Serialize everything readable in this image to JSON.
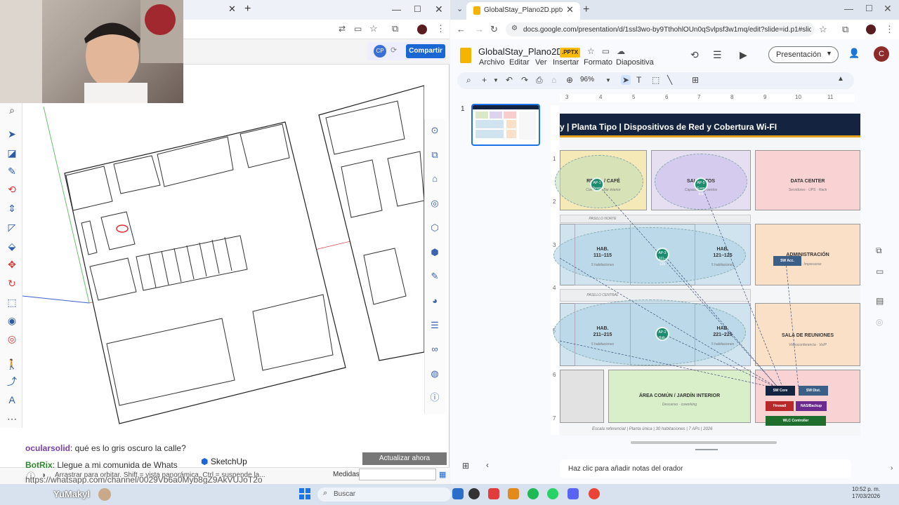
{
  "sketchup": {
    "collab_avatar": "CP",
    "share_label": "Compartir",
    "update_label": "Actualizar ahora",
    "app_badge": "SketchUp",
    "status_hint": "Arrastrar para orbitar. Shift = vista panorámica. Ctrl = suspende la...",
    "measures_label": "Medidas",
    "measures_value": ""
  },
  "chat": {
    "msg1_user": "ocularsolid",
    "msg1_text": ": qué es lo gris oscuro la calle?",
    "msg2_user": "BotRix",
    "msg2_text": ": Llegue a mi comunida de Whats",
    "msg3_text": "https://whatsapp.com/channel/0029Vb6a0Myb8gZ9AkVUJoT2o"
  },
  "browser": {
    "tab_title": "GlobalStay_Plano2D.pptx - Pres",
    "url": "docs.google.com/presentation/d/1ssl3wo-by9TthohlOUn0qSvlpsf3w1mq/edit?slide=id.p1#slide=i..."
  },
  "slides": {
    "doc_title": "GlobalStay_Plano2D",
    "file_badge": ".PPTX",
    "menus": [
      "Archivo",
      "Editar",
      "Ver",
      "Insertar",
      "Formato",
      "Diapositiva"
    ],
    "present_label": "Presentación",
    "user_initial": "C",
    "zoom": "96%",
    "slide_number": "1",
    "ruler_h": [
      "3",
      "4",
      "5",
      "6",
      "7",
      "8",
      "9",
      "10",
      "11"
    ],
    "ruler_v": [
      "1",
      "2",
      "3",
      "4",
      "5",
      "6",
      "7"
    ],
    "notes_placeholder": "Haz clic para añadir notas del orador"
  },
  "slide": {
    "title": "y  |  Planta Tipo  |  Dispositivos de Red y Cobertura Wi-FI",
    "rooms": {
      "restaurant": "RESTA        / CAFÉ",
      "restaurant_sub": "Comedor · Bar interior",
      "meeting": "SALA        NTOS",
      "meeting_sub": "Capacidad · Eventos",
      "datacenter": "DATA CENTER",
      "datacenter_sub": "Servidores · UPS · Rack",
      "hab1a": "HAB.",
      "hab1a_num": "111–115",
      "hab1a_sub": "5 habitaciones",
      "hab1b": "HAB.",
      "hab1b_num": "121–125",
      "hab1b_sub": "5 habitaciones",
      "admin": "ADMINISTRACIÓN",
      "admin_sub": "PCs · Impresoras",
      "hab2a": "HAB.",
      "hab2a_num": "211–215",
      "hab2a_sub": "5 habitaciones",
      "hab2b": "HAB.",
      "hab2b_num": "221–225",
      "hab2b_sub": "5 habitaciones",
      "reunion": "SALA DE REUNIONES",
      "reunion_sub": "Videoconferencia · VoIP",
      "common": "ÁREA COMÚN / JARDÍN INTERIOR",
      "common_sub": "Descanso · coworking",
      "hall1": "PASILLO NORTE",
      "hall2": "PASILLO CENTRAL"
    },
    "aps": [
      "AP-1 Resto",
      "AP-5 Even tos",
      "AP-3 111–125",
      "AP-2 Hab."
    ],
    "devices": {
      "sw_acc": "SW Acc.",
      "sw_core": "SW Core",
      "sw_dist": "SW Dist.",
      "firewall": "Firewall",
      "storage": "NAS/Backup",
      "wlc": "WLC Controller"
    },
    "footer": "Escala referencial  |  Planta única  |  30 habitaciones  |  7 APs  |  2026"
  },
  "taskbar": {
    "user_overlay": "YuMakyl",
    "search_placeholder": "Buscar",
    "time": "10:52 p. m.",
    "date": "17/03/2026"
  },
  "colors": {
    "slides_accent": "#1a73e8",
    "slide_header": "#14233f",
    "slide_gold": "#e4a11b",
    "sketchup_share": "#1a66d2"
  }
}
